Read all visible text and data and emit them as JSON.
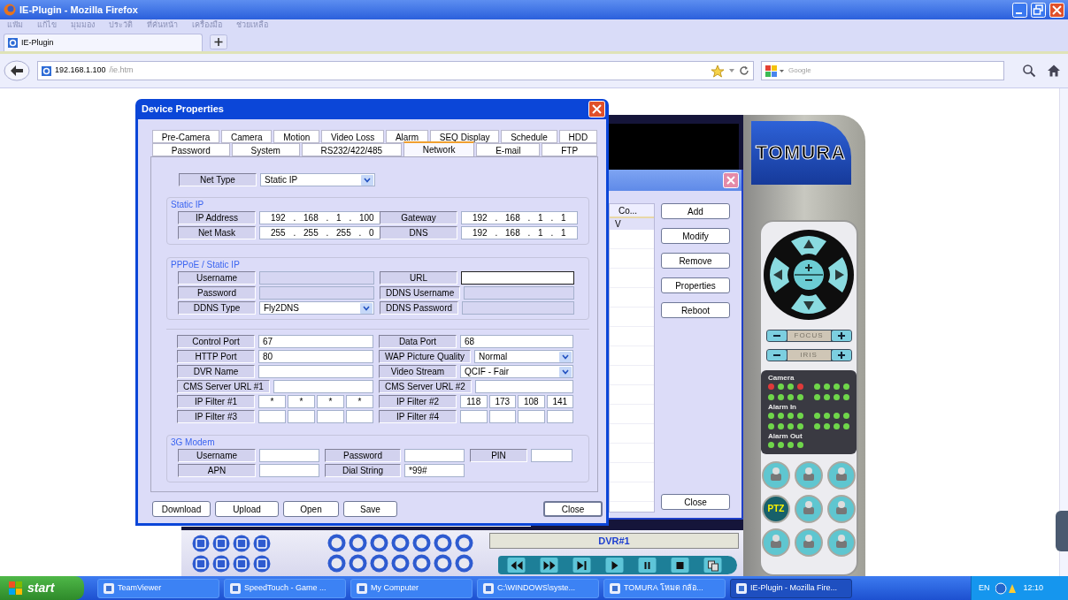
{
  "window": {
    "title": "IE-Plugin - Mozilla Firefox"
  },
  "menu": [
    "แฟ้ม",
    "แก้ไข",
    "มุมมอง",
    "ประวัติ",
    "ที่คั่นหน้า",
    "เครื่องมือ",
    "ช่วยเหลือ"
  ],
  "tabs": [
    {
      "label": "IE-Plugin",
      "selected": true
    }
  ],
  "address_bar": {
    "host": "192.168.1.100",
    "path": "/ie.htm"
  },
  "search": {
    "placeholder": "Google"
  },
  "dvr_app": {
    "list_window": {
      "columns": [
        "Co..."
      ],
      "rows": [
        [
          "V"
        ]
      ],
      "buttons": [
        "Add",
        "Modify",
        "Remove",
        "Properties",
        "Reboot"
      ],
      "close_button": "Close"
    },
    "logo": "TOMURA",
    "focus_label": "FOCUS",
    "iris_label": "IRIS",
    "status_groups": [
      {
        "label": "Camera",
        "leds": [
          {
            "color": "#e03a3a"
          },
          {
            "color": "#6fd64a"
          },
          {
            "color": "#6fd64a"
          },
          {
            "color": "#e03a3a"
          },
          {
            "color": "#6fd64a"
          },
          {
            "color": "#6fd64a"
          },
          {
            "color": "#6fd64a"
          },
          {
            "color": "#6fd64a"
          },
          {
            "color": "#6fd64a"
          },
          {
            "color": "#6fd64a"
          },
          {
            "color": "#6fd64a"
          },
          {
            "color": "#6fd64a"
          },
          {
            "color": "#6fd64a"
          },
          {
            "color": "#6fd64a"
          },
          {
            "color": "#6fd64a"
          },
          {
            "color": "#6fd64a"
          }
        ]
      },
      {
        "label": "Alarm In",
        "leds": [
          {
            "color": "#6fd64a"
          },
          {
            "color": "#6fd64a"
          },
          {
            "color": "#6fd64a"
          },
          {
            "color": "#6fd64a"
          },
          {
            "color": "#6fd64a"
          },
          {
            "color": "#6fd64a"
          },
          {
            "color": "#6fd64a"
          },
          {
            "color": "#6fd64a"
          },
          {
            "color": "#6fd64a"
          },
          {
            "color": "#6fd64a"
          },
          {
            "color": "#6fd64a"
          },
          {
            "color": "#6fd64a"
          },
          {
            "color": "#6fd64a"
          },
          {
            "color": "#6fd64a"
          },
          {
            "color": "#6fd64a"
          },
          {
            "color": "#6fd64a"
          }
        ]
      },
      {
        "label": "Alarm Out",
        "leds": [
          {
            "color": "#6fd64a"
          },
          {
            "color": "#6fd64a"
          },
          {
            "color": "#6fd64a"
          },
          {
            "color": "#6fd64a"
          }
        ]
      }
    ],
    "ptz_button": "PTZ",
    "channel_label": "DVR#1"
  },
  "dialog": {
    "title": "Device Properties",
    "tab_rows": [
      [
        {
          "label": "Pre-Camera",
          "selected": false
        },
        {
          "label": "Camera",
          "selected": false
        },
        {
          "label": "Motion",
          "selected": false
        },
        {
          "label": "Video Loss",
          "selected": false
        },
        {
          "label": "Alarm",
          "selected": false
        },
        {
          "label": "SEQ Display",
          "selected": false
        },
        {
          "label": "Schedule",
          "selected": false
        },
        {
          "label": "HDD",
          "selected": false
        }
      ],
      [
        {
          "label": "Password",
          "selected": false
        },
        {
          "label": "System",
          "selected": false
        },
        {
          "label": "RS232/422/485",
          "selected": false
        },
        {
          "label": "Network",
          "selected": true
        },
        {
          "label": "E-mail",
          "selected": false
        },
        {
          "label": "FTP",
          "selected": false
        }
      ]
    ],
    "net_type": {
      "label": "Net Type",
      "kind": "select",
      "value": "Static IP"
    },
    "groups": [
      {
        "title": "Static IP",
        "rows": [
          [
            {
              "label": "IP Address",
              "kind": "ip",
              "value": "192 . 168 . 1 . 100"
            },
            {
              "label": "Gateway",
              "kind": "ip",
              "value": "192 . 168 . 1 . 1"
            }
          ],
          [
            {
              "label": "Net Mask",
              "kind": "ip",
              "value": "255 . 255 . 255 . 0"
            },
            {
              "label": "DNS",
              "kind": "ip",
              "value": "192 . 168 . 1 . 1"
            }
          ]
        ]
      },
      {
        "title": "PPPoE / Static IP",
        "rows": [
          [
            {
              "label": "Username",
              "kind": "text",
              "disabled": true
            },
            {
              "label": "URL",
              "kind": "redacted",
              "disabled": false
            }
          ],
          [
            {
              "label": "Password",
              "kind": "text",
              "disabled": true
            },
            {
              "label": "DDNS Username",
              "kind": "text",
              "disabled": true
            }
          ],
          [
            {
              "label": "DDNS Type",
              "kind": "select",
              "value": "Fly2DNS",
              "disabled": false
            },
            {
              "label": "DDNS Password",
              "kind": "text",
              "disabled": true
            }
          ]
        ]
      },
      {
        "rows": [
          [
            {
              "label": "Control Port",
              "kind": "text",
              "value": "67"
            },
            {
              "label": "Data Port",
              "kind": "text",
              "value": "68"
            }
          ],
          [
            {
              "label": "HTTP Port",
              "kind": "text",
              "value": "80"
            },
            {
              "label": "WAP Picture Quality",
              "kind": "select",
              "value": "Normal"
            }
          ],
          [
            {
              "label": "DVR Name",
              "kind": "text"
            },
            {
              "label": "Video Stream",
              "kind": "select",
              "value": "QCIF - Fair"
            }
          ],
          [
            {
              "label": "CMS Server URL #1",
              "kind": "text"
            },
            {
              "label": "CMS Server URL #2",
              "kind": "text"
            }
          ],
          [
            {
              "label": "IP Filter #1",
              "kind": "octets",
              "octets": [
                "*",
                "*",
                "*",
                "*"
              ]
            },
            {
              "label": "IP Filter #2",
              "kind": "octets",
              "octets": [
                "118",
                "173",
                "108",
                "141"
              ]
            }
          ],
          [
            {
              "label": "IP Filter #3",
              "kind": "octets"
            },
            {
              "label": "IP Filter #4",
              "kind": "octets"
            }
          ]
        ]
      },
      {
        "title": "3G Modem",
        "kind": "modem",
        "rows": [
          [
            {
              "label": "Username",
              "kind": "text"
            },
            {
              "label": "Password",
              "kind": "text"
            },
            {
              "label": "PIN",
              "kind": "text"
            }
          ],
          [
            {
              "label": "APN",
              "kind": "text"
            },
            {
              "label": "Dial String",
              "kind": "text",
              "value": "*99#"
            }
          ]
        ]
      }
    ],
    "buttons": [
      "Download",
      "Upload",
      "Open",
      "Save"
    ],
    "close_button": "Close"
  },
  "taskbar": {
    "start": "start",
    "items": [
      {
        "label": "TeamViewer",
        "selected": false
      },
      {
        "label": "SpeedTouch - Game ...",
        "selected": false
      },
      {
        "label": "My Computer",
        "selected": false
      },
      {
        "label": "C:\\WINDOWS\\syste...",
        "selected": false
      },
      {
        "label": "TOMURA โหมด กล้อ...",
        "selected": false
      },
      {
        "label": "IE-Plugin - Mozilla Fire...",
        "selected": true
      }
    ],
    "language": "EN",
    "time": "12:10"
  }
}
